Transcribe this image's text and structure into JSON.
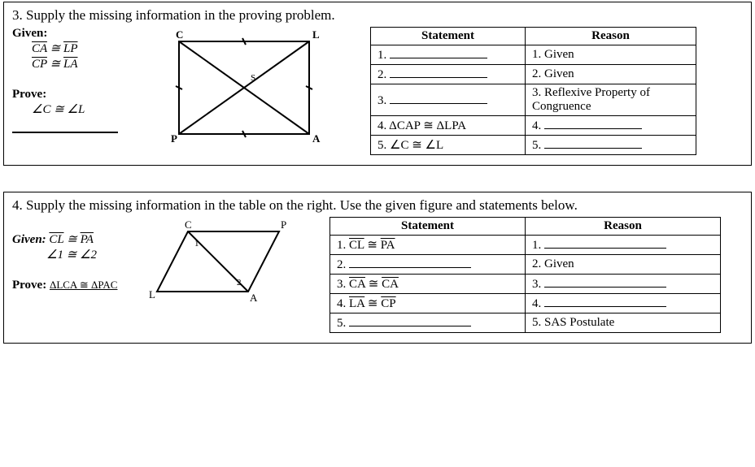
{
  "p3": {
    "title": "3. Supply the missing information in the proving problem.",
    "given_label": "Given:",
    "given1_html": "CA ≅ LP",
    "given1_left": "CA",
    "given1_right": "LP",
    "given2_left": "CP",
    "given2_right": "LA",
    "prove_label": "Prove:",
    "prove_text": "∠C ≅ ∠L",
    "table": {
      "h1": "Statement",
      "h2": "Reason",
      "s1_pre": "1. ",
      "s2_pre": "2. ",
      "s3_pre": "3. ",
      "s4": "4. ΔCAP ≅ ΔLPA",
      "s5": "5. ∠C ≅ ∠L",
      "r1": "1. Given",
      "r2": "2. Given",
      "r3": "3. Reflexive Property of Congruence",
      "r4_pre": "4. ",
      "r5_pre": "5. "
    },
    "fig": {
      "C": "C",
      "L": "L",
      "P": "P",
      "A": "A",
      "S": "S"
    }
  },
  "p4": {
    "title": "4. Supply the missing information in the table on the right. Use the given figure and statements below.",
    "given_label": "Given:",
    "given1_left": "CL",
    "given1_right": "PA",
    "given2": "∠1 ≅ ∠2",
    "prove_label": "Prove:",
    "prove_text": "ΔLCA ≅ ΔPAC",
    "table": {
      "h1": "Statement",
      "h2": "Reason",
      "s1_pre": "1. ",
      "s1_left": "CL",
      "s1_right": "PA",
      "s2_pre": "2. ",
      "s3_pre": "3. ",
      "s3_left": "CA",
      "s3_right": "CA",
      "s4_pre": "4. ",
      "s4_left": "LA",
      "s4_right": "CP",
      "s5_pre": "5. ",
      "r1_pre": "1. ",
      "r2": "2. Given",
      "r3_pre": "3. ",
      "r4_pre": "4. ",
      "r5": "5. SAS Postulate"
    },
    "fig": {
      "C": "C",
      "P": "P",
      "L": "L",
      "A": "A",
      "a1": "1",
      "a2": "2"
    }
  }
}
